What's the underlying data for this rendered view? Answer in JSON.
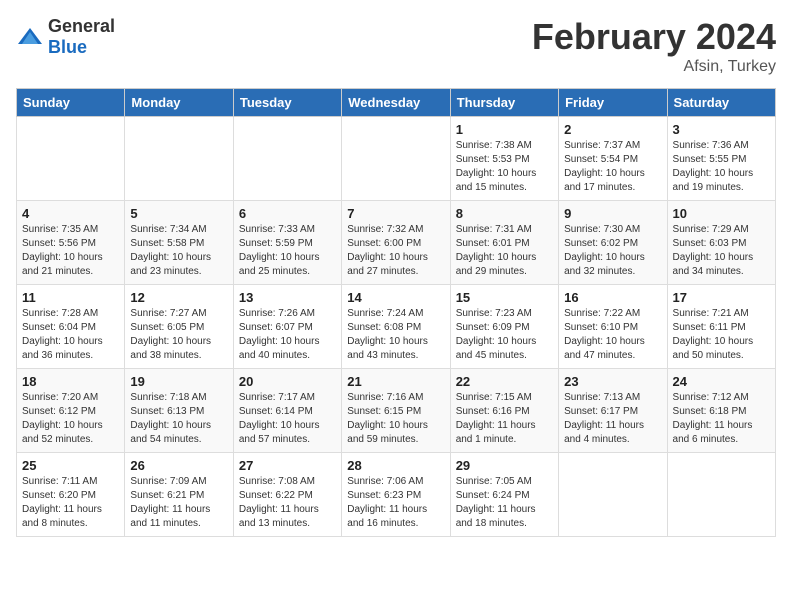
{
  "header": {
    "logo": {
      "general": "General",
      "blue": "Blue"
    },
    "title": "February 2024",
    "subtitle": "Afsin, Turkey"
  },
  "weekdays": [
    "Sunday",
    "Monday",
    "Tuesday",
    "Wednesday",
    "Thursday",
    "Friday",
    "Saturday"
  ],
  "weeks": [
    [
      {
        "day": "",
        "content": ""
      },
      {
        "day": "",
        "content": ""
      },
      {
        "day": "",
        "content": ""
      },
      {
        "day": "",
        "content": ""
      },
      {
        "day": "1",
        "content": "Sunrise: 7:38 AM\nSunset: 5:53 PM\nDaylight: 10 hours and 15 minutes."
      },
      {
        "day": "2",
        "content": "Sunrise: 7:37 AM\nSunset: 5:54 PM\nDaylight: 10 hours and 17 minutes."
      },
      {
        "day": "3",
        "content": "Sunrise: 7:36 AM\nSunset: 5:55 PM\nDaylight: 10 hours and 19 minutes."
      }
    ],
    [
      {
        "day": "4",
        "content": "Sunrise: 7:35 AM\nSunset: 5:56 PM\nDaylight: 10 hours and 21 minutes."
      },
      {
        "day": "5",
        "content": "Sunrise: 7:34 AM\nSunset: 5:58 PM\nDaylight: 10 hours and 23 minutes."
      },
      {
        "day": "6",
        "content": "Sunrise: 7:33 AM\nSunset: 5:59 PM\nDaylight: 10 hours and 25 minutes."
      },
      {
        "day": "7",
        "content": "Sunrise: 7:32 AM\nSunset: 6:00 PM\nDaylight: 10 hours and 27 minutes."
      },
      {
        "day": "8",
        "content": "Sunrise: 7:31 AM\nSunset: 6:01 PM\nDaylight: 10 hours and 29 minutes."
      },
      {
        "day": "9",
        "content": "Sunrise: 7:30 AM\nSunset: 6:02 PM\nDaylight: 10 hours and 32 minutes."
      },
      {
        "day": "10",
        "content": "Sunrise: 7:29 AM\nSunset: 6:03 PM\nDaylight: 10 hours and 34 minutes."
      }
    ],
    [
      {
        "day": "11",
        "content": "Sunrise: 7:28 AM\nSunset: 6:04 PM\nDaylight: 10 hours and 36 minutes."
      },
      {
        "day": "12",
        "content": "Sunrise: 7:27 AM\nSunset: 6:05 PM\nDaylight: 10 hours and 38 minutes."
      },
      {
        "day": "13",
        "content": "Sunrise: 7:26 AM\nSunset: 6:07 PM\nDaylight: 10 hours and 40 minutes."
      },
      {
        "day": "14",
        "content": "Sunrise: 7:24 AM\nSunset: 6:08 PM\nDaylight: 10 hours and 43 minutes."
      },
      {
        "day": "15",
        "content": "Sunrise: 7:23 AM\nSunset: 6:09 PM\nDaylight: 10 hours and 45 minutes."
      },
      {
        "day": "16",
        "content": "Sunrise: 7:22 AM\nSunset: 6:10 PM\nDaylight: 10 hours and 47 minutes."
      },
      {
        "day": "17",
        "content": "Sunrise: 7:21 AM\nSunset: 6:11 PM\nDaylight: 10 hours and 50 minutes."
      }
    ],
    [
      {
        "day": "18",
        "content": "Sunrise: 7:20 AM\nSunset: 6:12 PM\nDaylight: 10 hours and 52 minutes."
      },
      {
        "day": "19",
        "content": "Sunrise: 7:18 AM\nSunset: 6:13 PM\nDaylight: 10 hours and 54 minutes."
      },
      {
        "day": "20",
        "content": "Sunrise: 7:17 AM\nSunset: 6:14 PM\nDaylight: 10 hours and 57 minutes."
      },
      {
        "day": "21",
        "content": "Sunrise: 7:16 AM\nSunset: 6:15 PM\nDaylight: 10 hours and 59 minutes."
      },
      {
        "day": "22",
        "content": "Sunrise: 7:15 AM\nSunset: 6:16 PM\nDaylight: 11 hours and 1 minute."
      },
      {
        "day": "23",
        "content": "Sunrise: 7:13 AM\nSunset: 6:17 PM\nDaylight: 11 hours and 4 minutes."
      },
      {
        "day": "24",
        "content": "Sunrise: 7:12 AM\nSunset: 6:18 PM\nDaylight: 11 hours and 6 minutes."
      }
    ],
    [
      {
        "day": "25",
        "content": "Sunrise: 7:11 AM\nSunset: 6:20 PM\nDaylight: 11 hours and 8 minutes."
      },
      {
        "day": "26",
        "content": "Sunrise: 7:09 AM\nSunset: 6:21 PM\nDaylight: 11 hours and 11 minutes."
      },
      {
        "day": "27",
        "content": "Sunrise: 7:08 AM\nSunset: 6:22 PM\nDaylight: 11 hours and 13 minutes."
      },
      {
        "day": "28",
        "content": "Sunrise: 7:06 AM\nSunset: 6:23 PM\nDaylight: 11 hours and 16 minutes."
      },
      {
        "day": "29",
        "content": "Sunrise: 7:05 AM\nSunset: 6:24 PM\nDaylight: 11 hours and 18 minutes."
      },
      {
        "day": "",
        "content": ""
      },
      {
        "day": "",
        "content": ""
      }
    ]
  ]
}
